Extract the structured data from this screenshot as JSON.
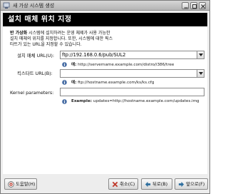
{
  "window": {
    "title": "새 가상 시스템 생성"
  },
  "banner": {
    "title": "설치 매체 위치 지정"
  },
  "description": {
    "bold_prefix": "반 가상화",
    "line1_rest": " 시스템에 설치하려는 운영 체제가 사용 가능한",
    "line2": "설치 매체의 위치를 지정합니다. 또한, 시스템에 대한 픽스",
    "line3": "타트가 있는 URL을 지정할 수 있습니다."
  },
  "install_url": {
    "label": "설치 매체 URL(U):",
    "value": "ftp://192.168.0.6/pub/SUL2",
    "hint_label": "예:",
    "hint_value": "http://servername.example.com/distro/i386/tree"
  },
  "kickstart_url": {
    "label": "킥스타트 URL(B):",
    "value": "",
    "hint_label": "예:",
    "hint_value": "ftp://hostname.example.com/ks/ks.cfg"
  },
  "kernel_params": {
    "label": "Kernel parameters:",
    "value": "",
    "hint_label": "Example:",
    "hint_value": "updates=http://hostname.example.com/updates.img"
  },
  "buttons": {
    "help": "도움말(H)",
    "cancel": "취소(C)",
    "back": "뒤로(B)",
    "forward": "앞으로(F)"
  },
  "colors": {
    "banner_bg": "#000000",
    "banner_text": "#ffffff",
    "info_icon": "#4a6fa5",
    "cancel_icon": "#c0392b"
  }
}
